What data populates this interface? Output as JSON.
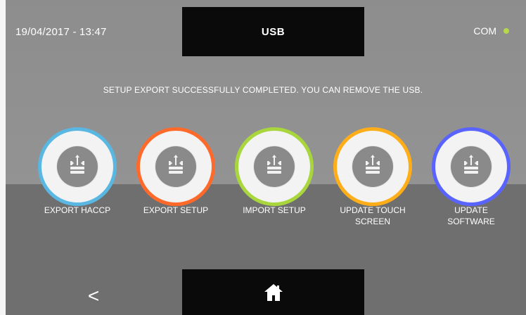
{
  "header": {
    "datetime": "19/04/2017 - 13:47",
    "title": "USB",
    "status_label": "COM",
    "status_color": "#b6d84a"
  },
  "message": "SETUP EXPORT SUCCESSFULLY COMPLETED. YOU CAN REMOVE THE USB.",
  "actions": [
    {
      "label": "EXPORT HACCP",
      "ring_color": "#59b7e2",
      "icon": "usb-icon"
    },
    {
      "label": "EXPORT SETUP",
      "ring_color": "#ff6a2b",
      "icon": "usb-icon"
    },
    {
      "label": "IMPORT SETUP",
      "ring_color": "#a9d63c",
      "icon": "usb-icon"
    },
    {
      "label": "UPDATE TOUCH\nSCREEN",
      "ring_color": "#ffae1a",
      "icon": "usb-icon"
    },
    {
      "label": "UPDATE\nSOFTWARE",
      "ring_color": "#5963ff",
      "icon": "usb-icon"
    }
  ],
  "footer": {
    "back_label": "<",
    "home_icon": "home-icon"
  }
}
